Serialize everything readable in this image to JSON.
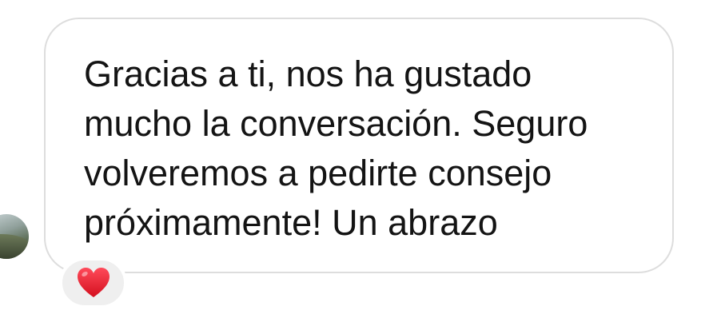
{
  "message": {
    "lines": [
      "Gracias a ti, nos ha gustado",
      "mucho la conversación. Seguro",
      "volveremos a pedirte consejo",
      "próximamente! Un abrazo"
    ]
  },
  "reaction": {
    "icon": "red-heart-icon",
    "color": "#e0182d"
  },
  "avatar": {
    "icon": "profile-photo"
  },
  "colors": {
    "bubble_border": "#dddddd",
    "reaction_bg": "#efefef",
    "text": "#141414"
  }
}
